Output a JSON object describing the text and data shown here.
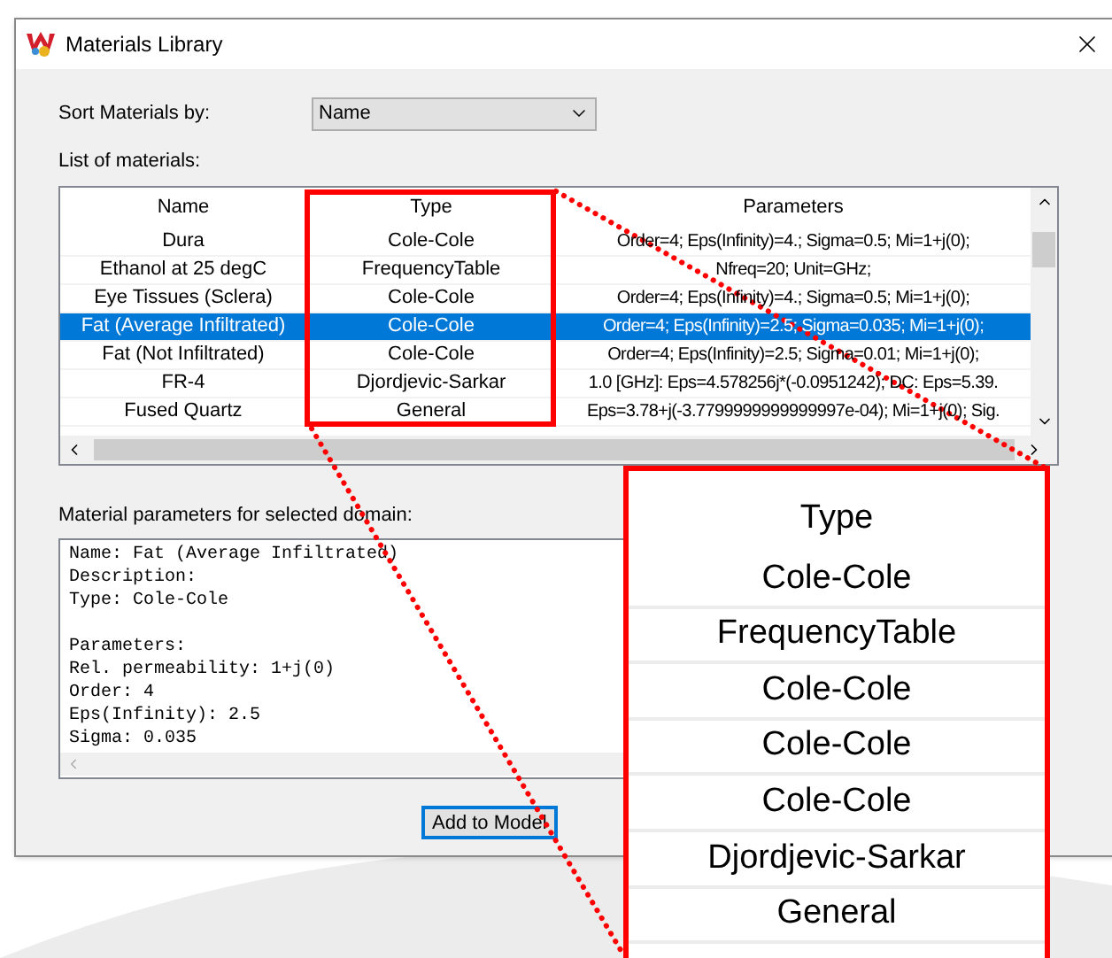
{
  "window": {
    "title": "Materials Library"
  },
  "sort": {
    "label": "Sort Materials by:",
    "value": "Name"
  },
  "list_label": "List of materials:",
  "table": {
    "columns": [
      "Name",
      "Type",
      "Parameters"
    ],
    "rows": [
      {
        "name": "Dura",
        "type": "Cole-Cole",
        "parameters": "Order=4; Eps(Infinity)=4.; Sigma=0.5; Mi=1+j(0);",
        "selected": false
      },
      {
        "name": "Ethanol at 25 degC",
        "type": "FrequencyTable",
        "parameters": "Nfreq=20; Unit=GHz;",
        "selected": false
      },
      {
        "name": "Eye Tissues (Sclera)",
        "type": "Cole-Cole",
        "parameters": "Order=4; Eps(Infinity)=4.; Sigma=0.5; Mi=1+j(0);",
        "selected": false
      },
      {
        "name": "Fat (Average Infiltrated)",
        "type": "Cole-Cole",
        "parameters": "Order=4; Eps(Infinity)=2.5; Sigma=0.035; Mi=1+j(0);",
        "selected": true
      },
      {
        "name": "Fat (Not Infiltrated)",
        "type": "Cole-Cole",
        "parameters": "Order=4; Eps(Infinity)=2.5; Sigma=0.01; Mi=1+j(0);",
        "selected": false
      },
      {
        "name": "FR-4",
        "type": "Djordjevic-Sarkar",
        "parameters": "1.0 [GHz]: Eps=4.578256j*(-0.0951242); DC: Eps=5.39.",
        "selected": false
      },
      {
        "name": "Fused Quartz",
        "type": "General",
        "parameters": "Eps=3.78+j(-3.7799999999999997e-04); Mi=1+j(0); Sig.",
        "selected": false
      }
    ]
  },
  "details": {
    "label": "Material parameters for selected domain:",
    "header_lines": [
      "Name: Fat (Average Infiltrated)",
      "Description:",
      "Type: Cole-Cole"
    ],
    "parameter_lines": [
      "Parameters:",
      "Rel. permeability: 1+j(0)",
      "Order: 4",
      "Eps(Infinity): 2.5",
      "Sigma: 0.035"
    ]
  },
  "button": "Add to Model",
  "callout": {
    "header": "Type",
    "cells": [
      "Cole-Cole",
      "FrequencyTable",
      "Cole-Cole",
      "Cole-Cole",
      "Cole-Cole",
      "Djordjevic-Sarkar",
      "General"
    ]
  }
}
